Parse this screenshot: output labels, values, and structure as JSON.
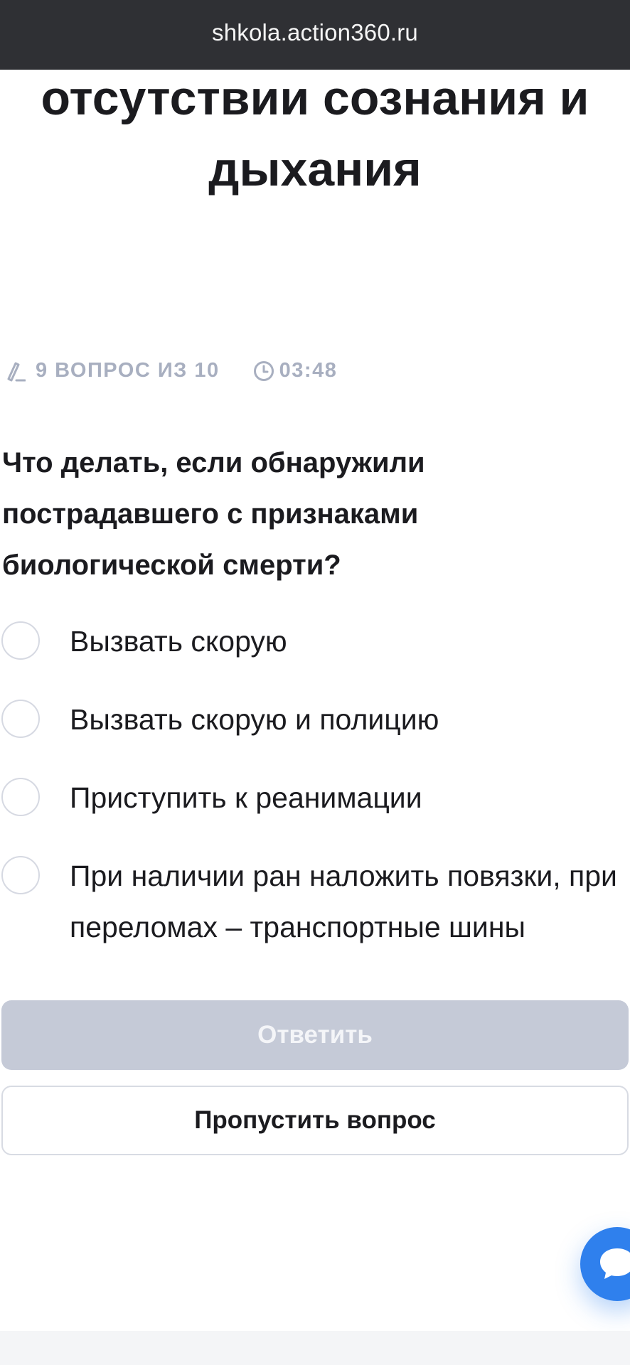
{
  "browser": {
    "url": "shkola.action360.ru"
  },
  "course": {
    "title_lines": [
      "отсутствии сознания и",
      "дыхания"
    ]
  },
  "meta": {
    "progress_icon": "pencil-icon",
    "progress_text": "9 ВОПРОС ИЗ 10",
    "timer_icon": "clock-icon",
    "timer_text": "03:48"
  },
  "question": {
    "text": "Что делать, если обнаружили пострадавшего с признаками биологической смерти?"
  },
  "options": [
    {
      "label": "Вызвать скорую"
    },
    {
      "label": "Вызвать скорую и полицию"
    },
    {
      "label": "Приступить к реанимации"
    },
    {
      "label": "При наличии ран наложить повязки, при переломах – транспортные шины"
    }
  ],
  "buttons": {
    "answer_label": "Ответить",
    "skip_label": "Пропустить вопрос"
  },
  "chat": {
    "icon": "chat-bubble-icon"
  },
  "colors": {
    "url_bar": "#2f3034",
    "meta_text": "#a8afc0",
    "answer_disabled": "#c5cad7",
    "chat_accent": "#2f80ed"
  }
}
